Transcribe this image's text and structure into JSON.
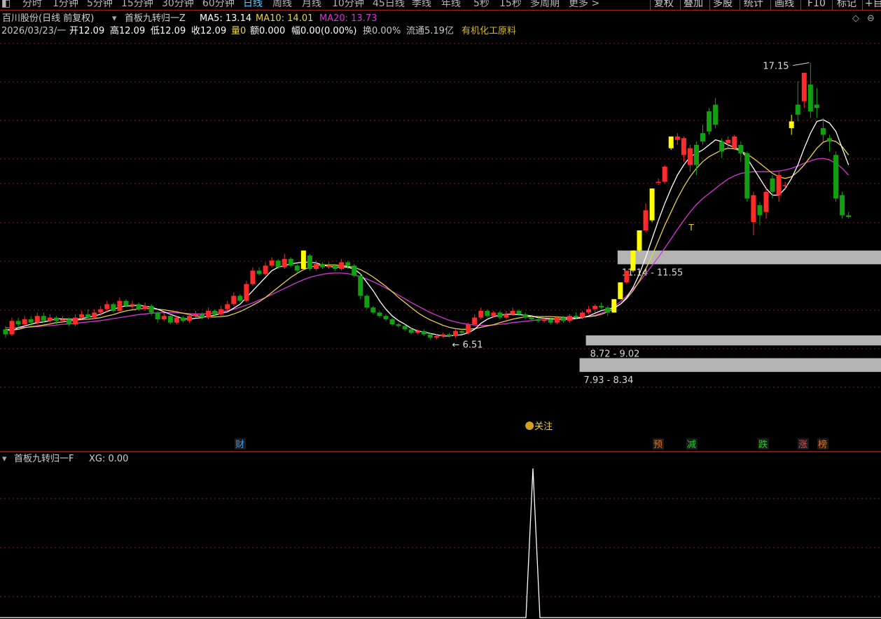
{
  "toolbar": {
    "tabs": [
      "分时",
      "1分钟",
      "5分钟",
      "15分钟",
      "30分钟",
      "60分钟",
      "日线",
      "周线",
      "月线",
      "10分钟",
      "45日线",
      "季线",
      "年线",
      "5秒",
      "15秒",
      "多周期",
      "更多 >"
    ],
    "active_index": 6,
    "right_buttons": [
      "复权",
      "叠加",
      "多股",
      "统计",
      "画线",
      "F10",
      "标记",
      "+自"
    ]
  },
  "header": {
    "stock_name": "百川股份(日线 前复权)",
    "indicator_name": "首板九转归一Z",
    "ma5": "MA5: 13.14",
    "ma10": "MA10: 14.01",
    "ma20": "MA20: 13.73"
  },
  "info": {
    "date": "2026/03/23/一",
    "open": "开12.09",
    "high": "高12.09",
    "low": "低12.09",
    "close": "收12.09",
    "volume": "量0",
    "amount": "额0.000",
    "change": "幅0.00(0.00%)",
    "turnover": "换0.00%",
    "float_cap": "流通5.19亿",
    "industry": "有机化工原料"
  },
  "sub_panel": {
    "indicator_name": "首板九转归一F",
    "xg_label": "XG: 0.00"
  },
  "colors": {
    "up": "#ff2b2b",
    "down": "#12a012",
    "signal": "#ffff00",
    "ma5": "#ffffff",
    "ma10": "#e8d24a",
    "ma20": "#d535d5",
    "zone": "#b4b4b4",
    "grid": "#8a1a1a"
  },
  "chart_data": {
    "type": "candlestick",
    "period": "daily",
    "price_scale": [
      6.2,
      17.6
    ],
    "candles": [
      [
        9.2,
        9.05,
        9.3,
        8.95,
        "d"
      ],
      [
        9.05,
        9.45,
        9.55,
        9.0,
        "u"
      ],
      [
        9.45,
        9.35,
        9.55,
        9.25,
        "d"
      ],
      [
        9.35,
        9.5,
        9.6,
        9.3,
        "u"
      ],
      [
        9.5,
        9.4,
        9.6,
        9.3,
        "d"
      ],
      [
        9.4,
        9.6,
        9.7,
        9.35,
        "u"
      ],
      [
        9.6,
        9.45,
        9.7,
        9.4,
        "d"
      ],
      [
        9.45,
        9.55,
        9.65,
        9.4,
        "u"
      ],
      [
        9.55,
        9.45,
        9.6,
        9.35,
        "d"
      ],
      [
        9.45,
        9.5,
        9.6,
        9.4,
        "u"
      ],
      [
        9.5,
        9.35,
        9.55,
        9.3,
        "d"
      ],
      [
        9.35,
        9.55,
        9.65,
        9.3,
        "u"
      ],
      [
        9.55,
        9.65,
        9.75,
        9.5,
        "u"
      ],
      [
        9.65,
        9.55,
        9.8,
        9.5,
        "d"
      ],
      [
        9.55,
        9.7,
        9.8,
        9.5,
        "u"
      ],
      [
        9.7,
        9.8,
        9.9,
        9.6,
        "u"
      ],
      [
        9.8,
        9.95,
        10.05,
        9.7,
        "u"
      ],
      [
        9.95,
        9.75,
        10.0,
        9.7,
        "d"
      ],
      [
        9.75,
        10.05,
        10.15,
        9.7,
        "u"
      ],
      [
        10.05,
        9.9,
        10.1,
        9.85,
        "d"
      ],
      [
        9.9,
        9.95,
        10.05,
        9.8,
        "u"
      ],
      [
        9.95,
        9.8,
        10.0,
        9.75,
        "d"
      ],
      [
        9.8,
        9.9,
        10.0,
        9.75,
        "u"
      ],
      [
        9.9,
        9.7,
        9.95,
        9.6,
        "d"
      ],
      [
        9.7,
        9.5,
        9.75,
        9.4,
        "d"
      ],
      [
        9.5,
        9.6,
        9.7,
        9.45,
        "u"
      ],
      [
        9.6,
        9.4,
        9.65,
        9.35,
        "d"
      ],
      [
        9.4,
        9.55,
        9.6,
        9.35,
        "u"
      ],
      [
        9.55,
        9.45,
        9.6,
        9.4,
        "d"
      ],
      [
        9.45,
        9.6,
        9.65,
        9.4,
        "u"
      ],
      [
        9.6,
        9.65,
        9.75,
        9.55,
        "u"
      ],
      [
        9.65,
        9.55,
        9.7,
        9.5,
        "d"
      ],
      [
        9.55,
        9.75,
        9.85,
        9.5,
        "u"
      ],
      [
        9.75,
        9.65,
        9.8,
        9.6,
        "d"
      ],
      [
        9.65,
        9.8,
        9.9,
        9.6,
        "u"
      ],
      [
        9.8,
        9.95,
        10.05,
        9.75,
        "u"
      ],
      [
        9.95,
        10.2,
        10.3,
        9.9,
        "u"
      ],
      [
        10.2,
        10.05,
        10.25,
        10.0,
        "d"
      ],
      [
        10.05,
        10.55,
        10.65,
        10.0,
        "u"
      ],
      [
        10.55,
        10.95,
        11.05,
        10.5,
        "u"
      ],
      [
        10.95,
        10.85,
        11.05,
        10.8,
        "d"
      ],
      [
        10.85,
        11.1,
        11.2,
        10.8,
        "u"
      ],
      [
        11.1,
        11.25,
        11.35,
        11.05,
        "u"
      ],
      [
        11.25,
        11.05,
        11.3,
        11.0,
        "d"
      ],
      [
        11.05,
        11.3,
        11.45,
        11.0,
        "u"
      ],
      [
        11.3,
        11.1,
        11.35,
        11.05,
        "d"
      ],
      [
        11.1,
        10.95,
        11.15,
        10.9,
        "d"
      ],
      [
        11.0,
        11.55,
        11.55,
        11.0,
        "s"
      ],
      [
        11.4,
        11.0,
        11.45,
        10.95,
        "d"
      ],
      [
        11.0,
        11.15,
        11.25,
        10.95,
        "u"
      ],
      [
        11.15,
        11.05,
        11.2,
        11.0,
        "d"
      ],
      [
        11.05,
        11.1,
        11.2,
        11.0,
        "u"
      ],
      [
        11.1,
        11.0,
        11.15,
        10.95,
        "d"
      ],
      [
        11.0,
        11.2,
        11.3,
        10.95,
        "u"
      ],
      [
        11.2,
        11.1,
        11.25,
        11.0,
        "d"
      ],
      [
        11.1,
        10.8,
        11.15,
        10.75,
        "d"
      ],
      [
        10.8,
        10.2,
        10.85,
        10.1,
        "d"
      ],
      [
        10.2,
        9.85,
        10.25,
        9.8,
        "d"
      ],
      [
        9.85,
        9.7,
        9.9,
        9.65,
        "d"
      ],
      [
        9.7,
        9.6,
        9.75,
        9.55,
        "d"
      ],
      [
        9.6,
        9.5,
        9.65,
        9.45,
        "d"
      ],
      [
        9.5,
        9.35,
        9.55,
        9.3,
        "d"
      ],
      [
        9.35,
        9.3,
        9.4,
        9.25,
        "d"
      ],
      [
        9.3,
        9.2,
        9.35,
        9.15,
        "d"
      ],
      [
        9.2,
        9.1,
        9.25,
        9.05,
        "d"
      ],
      [
        9.1,
        9.15,
        9.2,
        9.05,
        "u"
      ],
      [
        9.15,
        9.05,
        9.2,
        9.0,
        "d"
      ],
      [
        9.05,
        8.95,
        9.1,
        8.9,
        "d"
      ],
      [
        8.95,
        9.0,
        9.05,
        8.9,
        "u"
      ],
      [
        9.0,
        9.05,
        9.1,
        8.95,
        "u"
      ],
      [
        9.05,
        9.0,
        9.1,
        8.95,
        "d"
      ],
      [
        9.0,
        9.15,
        9.2,
        8.95,
        "u"
      ],
      [
        9.15,
        9.1,
        9.2,
        9.05,
        "d"
      ],
      [
        9.1,
        9.35,
        9.4,
        9.05,
        "u"
      ],
      [
        9.35,
        9.55,
        9.65,
        9.3,
        "u"
      ],
      [
        9.55,
        9.75,
        9.85,
        9.5,
        "u"
      ],
      [
        9.75,
        9.6,
        9.8,
        9.55,
        "d"
      ],
      [
        9.6,
        9.7,
        9.75,
        9.55,
        "u"
      ],
      [
        9.7,
        9.55,
        9.75,
        9.5,
        "d"
      ],
      [
        9.55,
        9.65,
        9.75,
        9.5,
        "u"
      ],
      [
        9.65,
        9.75,
        9.85,
        9.6,
        "u"
      ],
      [
        9.75,
        9.65,
        9.8,
        9.6,
        "d"
      ],
      [
        9.65,
        9.55,
        9.7,
        9.5,
        "d"
      ],
      [
        9.55,
        9.5,
        9.6,
        9.45,
        "d"
      ],
      [
        9.5,
        9.45,
        9.55,
        9.4,
        "d"
      ],
      [
        9.45,
        9.5,
        9.6,
        9.4,
        "u"
      ],
      [
        9.5,
        9.4,
        9.55,
        9.35,
        "d"
      ],
      [
        9.4,
        9.55,
        9.6,
        9.35,
        "u"
      ],
      [
        9.55,
        9.45,
        9.6,
        9.4,
        "d"
      ],
      [
        9.45,
        9.6,
        9.65,
        9.4,
        "u"
      ],
      [
        9.6,
        9.55,
        9.7,
        9.5,
        "d"
      ],
      [
        9.55,
        9.7,
        9.75,
        9.5,
        "u"
      ],
      [
        9.7,
        9.8,
        9.9,
        9.65,
        "u"
      ],
      [
        9.8,
        9.9,
        9.95,
        9.7,
        "u"
      ],
      [
        9.9,
        9.85,
        10.0,
        9.8,
        "d"
      ],
      [
        9.85,
        9.7,
        9.9,
        9.6,
        "d"
      ],
      [
        9.7,
        10.1,
        10.1,
        9.7,
        "s"
      ],
      [
        10.1,
        10.6,
        10.6,
        10.1,
        "s"
      ],
      [
        10.6,
        10.95,
        10.95,
        10.55,
        "u"
      ],
      [
        10.95,
        11.55,
        11.55,
        10.9,
        "s"
      ],
      [
        11.55,
        12.15,
        12.15,
        11.5,
        "s"
      ],
      [
        12.15,
        12.75,
        12.95,
        12.1,
        "u"
      ],
      [
        12.45,
        13.4,
        13.4,
        12.4,
        "s"
      ],
      [
        13.6,
        13.6,
        13.7,
        13.5,
        "u"
      ],
      [
        13.6,
        14.05,
        14.1,
        13.55,
        "u"
      ],
      [
        14.6,
        14.95,
        14.95,
        14.55,
        "s"
      ],
      [
        14.95,
        14.85,
        15.05,
        14.7,
        "u"
      ],
      [
        14.9,
        14.4,
        14.95,
        14.2,
        "u"
      ],
      [
        14.6,
        14.1,
        14.7,
        13.9,
        "u"
      ],
      [
        14.1,
        14.7,
        14.8,
        13.8,
        "d"
      ],
      [
        14.8,
        15.05,
        15.3,
        14.7,
        "d"
      ],
      [
        15.1,
        15.7,
        15.8,
        15.0,
        "d"
      ],
      [
        15.9,
        15.3,
        16.1,
        15.2,
        "d"
      ],
      [
        14.8,
        14.5,
        14.9,
        14.3,
        "d"
      ],
      [
        14.75,
        14.85,
        14.95,
        14.6,
        "u"
      ],
      [
        14.95,
        14.6,
        15.0,
        14.55,
        "u"
      ],
      [
        14.7,
        14.45,
        14.8,
        14.2,
        "d"
      ],
      [
        14.45,
        13.1,
        14.5,
        13.0,
        "d"
      ],
      [
        12.4,
        13.2,
        13.3,
        12.0,
        "u"
      ],
      [
        12.9,
        12.6,
        13.0,
        12.3,
        "d"
      ],
      [
        12.7,
        13.3,
        13.4,
        12.5,
        "u"
      ],
      [
        13.3,
        13.7,
        13.8,
        13.1,
        "d"
      ],
      [
        13.2,
        13.8,
        13.9,
        13.0,
        "u"
      ],
      [
        13.5,
        13.5,
        13.6,
        13.4,
        "u"
      ],
      [
        15.4,
        15.2,
        15.6,
        15.0,
        "s"
      ],
      [
        15.9,
        15.6,
        16.6,
        15.4,
        "d"
      ],
      [
        16.0,
        16.85,
        16.85,
        15.8,
        "u"
      ],
      [
        16.5,
        15.7,
        17.15,
        15.5,
        "d"
      ],
      [
        15.8,
        15.9,
        16.4,
        15.5,
        "d"
      ],
      [
        15.2,
        15.0,
        15.5,
        14.8,
        "d"
      ],
      [
        14.9,
        14.8,
        15.0,
        14.5,
        "d"
      ],
      [
        14.4,
        13.1,
        14.5,
        13.0,
        "d"
      ],
      [
        13.2,
        12.6,
        13.3,
        12.5,
        "d"
      ],
      [
        12.6,
        12.55,
        12.7,
        12.5,
        "d"
      ]
    ],
    "ma5": [
      9.2,
      9.15,
      9.25,
      9.3,
      9.35,
      9.4,
      9.42,
      9.46,
      9.52,
      9.51,
      9.5,
      9.5,
      9.52,
      9.56,
      9.6,
      9.65,
      9.73,
      9.8,
      9.86,
      9.9,
      9.9,
      9.92,
      9.89,
      9.86,
      9.8,
      9.72,
      9.65,
      9.58,
      9.52,
      9.5,
      9.53,
      9.55,
      9.6,
      9.62,
      9.68,
      9.72,
      9.83,
      9.95,
      10.15,
      10.35,
      10.55,
      10.75,
      10.95,
      11.05,
      11.1,
      11.15,
      11.18,
      11.2,
      11.2,
      11.18,
      11.12,
      11.08,
      11.05,
      11.06,
      11.05,
      11.0,
      10.85,
      10.6,
      10.35,
      10.05,
      9.8,
      9.6,
      9.46,
      9.35,
      9.23,
      9.15,
      9.12,
      9.08,
      9.04,
      9.0,
      9.0,
      9.02,
      9.04,
      9.1,
      9.2,
      9.38,
      9.5,
      9.58,
      9.62,
      9.65,
      9.65,
      9.64,
      9.62,
      9.6,
      9.55,
      9.53,
      9.52,
      9.5,
      9.5,
      9.5,
      9.52,
      9.55,
      9.6,
      9.68,
      9.76,
      9.8,
      9.85,
      9.95,
      10.15,
      10.45,
      10.85,
      11.35,
      11.9,
      12.45,
      12.95,
      13.4,
      13.8,
      14.1,
      14.35,
      14.45,
      14.55,
      14.7,
      14.85,
      14.8,
      14.7,
      14.62,
      14.55,
      14.3,
      14.0,
      13.7,
      13.4,
      13.2,
      13.2,
      13.4,
      13.7,
      14.1,
      14.6,
      15.05,
      15.4,
      15.45,
      15.35,
      15.1,
      14.6,
      14.1
    ],
    "ma10": [
      9.2,
      9.18,
      9.2,
      9.25,
      9.28,
      9.3,
      9.33,
      9.36,
      9.4,
      9.42,
      9.45,
      9.47,
      9.49,
      9.5,
      9.52,
      9.55,
      9.6,
      9.64,
      9.7,
      9.75,
      9.78,
      9.81,
      9.82,
      9.82,
      9.8,
      9.78,
      9.75,
      9.72,
      9.68,
      9.64,
      9.6,
      9.58,
      9.57,
      9.57,
      9.58,
      9.6,
      9.66,
      9.73,
      9.82,
      9.92,
      10.02,
      10.15,
      10.3,
      10.45,
      10.6,
      10.75,
      10.87,
      10.98,
      11.05,
      11.1,
      11.12,
      11.12,
      11.12,
      11.1,
      11.08,
      11.05,
      10.98,
      10.88,
      10.76,
      10.62,
      10.48,
      10.32,
      10.15,
      10.0,
      9.85,
      9.7,
      9.58,
      9.48,
      9.4,
      9.32,
      9.26,
      9.22,
      9.2,
      9.2,
      9.22,
      9.26,
      9.3,
      9.34,
      9.4,
      9.45,
      9.5,
      9.54,
      9.57,
      9.58,
      9.58,
      9.58,
      9.58,
      9.57,
      9.56,
      9.55,
      9.55,
      9.56,
      9.58,
      9.6,
      9.65,
      9.72,
      9.82,
      9.95,
      10.12,
      10.35,
      10.65,
      11.0,
      11.4,
      11.85,
      12.3,
      12.7,
      13.1,
      13.45,
      13.75,
      14.0,
      14.2,
      14.35,
      14.45,
      14.55,
      14.6,
      14.58,
      14.52,
      14.42,
      14.3,
      14.15,
      14.0,
      13.85,
      13.75,
      13.7,
      13.75,
      13.9,
      14.1,
      14.35,
      14.6,
      14.78,
      14.85,
      14.8,
      14.65,
      14.4
    ],
    "ma20": [
      9.25,
      9.24,
      9.25,
      9.26,
      9.27,
      9.28,
      9.3,
      9.31,
      9.33,
      9.35,
      9.36,
      9.38,
      9.4,
      9.42,
      9.44,
      9.46,
      9.49,
      9.52,
      9.55,
      9.58,
      9.61,
      9.64,
      9.66,
      9.68,
      9.69,
      9.7,
      9.7,
      9.69,
      9.68,
      9.67,
      9.66,
      9.66,
      9.67,
      9.69,
      9.72,
      9.76,
      9.8,
      9.86,
      9.92,
      9.99,
      10.07,
      10.15,
      10.24,
      10.33,
      10.42,
      10.51,
      10.6,
      10.68,
      10.75,
      10.8,
      10.84,
      10.87,
      10.88,
      10.88,
      10.86,
      10.82,
      10.77,
      10.7,
      10.62,
      10.53,
      10.43,
      10.33,
      10.22,
      10.11,
      10.0,
      9.9,
      9.8,
      9.7,
      9.62,
      9.54,
      9.47,
      9.42,
      9.38,
      9.35,
      9.33,
      9.32,
      9.32,
      9.33,
      9.35,
      9.37,
      9.4,
      9.42,
      9.44,
      9.46,
      9.48,
      9.49,
      9.5,
      9.51,
      9.52,
      9.53,
      9.54,
      9.56,
      9.58,
      9.62,
      9.68,
      9.76,
      9.88,
      10.02,
      10.2,
      10.4,
      10.62,
      10.86,
      11.1,
      11.35,
      11.62,
      11.9,
      12.18,
      12.45,
      12.7,
      12.92,
      13.1,
      13.25,
      13.4,
      13.55,
      13.68,
      13.78,
      13.85,
      13.88,
      13.9,
      13.9,
      13.9,
      13.9,
      13.92,
      13.95,
      14.0,
      14.07,
      14.15,
      14.22,
      14.28,
      14.3,
      14.25,
      14.15,
      14.0,
      13.8
    ],
    "support_zones": [
      {
        "label": "11.14 - 11.55",
        "low": 11.14,
        "high": 11.55,
        "start": 97
      },
      {
        "label": "8.72 - 9.02",
        "low": 8.72,
        "high": 9.02,
        "start": 92
      },
      {
        "label": "7.93 - 8.34",
        "low": 7.93,
        "high": 8.34,
        "start": 91
      }
    ],
    "annotations": {
      "high_label": "17.15",
      "low_label": "6.51",
      "follow_tag": "关注",
      "t_mark": "T"
    },
    "bottom_tags": [
      "财",
      "预",
      "减",
      "跌",
      "涨",
      "榜"
    ],
    "sub_indicator": {
      "name": "XG",
      "spike_index": 75,
      "spike_value": 1
    }
  }
}
